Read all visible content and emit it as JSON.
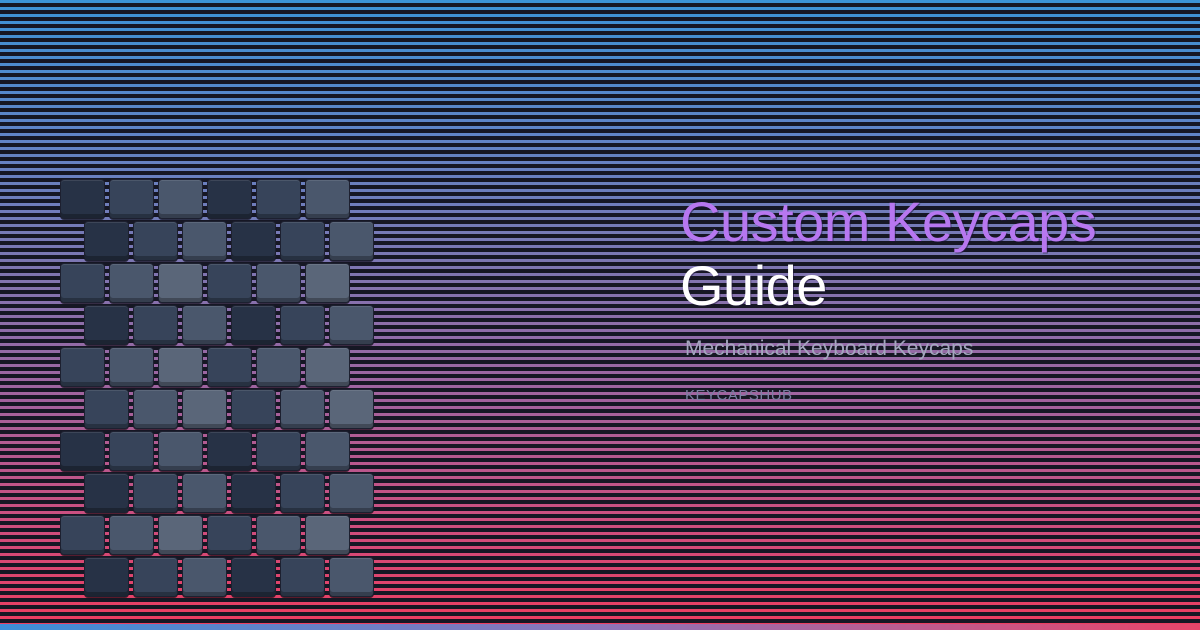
{
  "colors": {
    "title_accent": "#b777f0",
    "title_main": "#ffffff",
    "subtitle": "#a4a6be",
    "brand": "#7d7fa4",
    "stripe_top": "#3b93d6",
    "stripe_bottom": "#ee3c5f"
  },
  "title": {
    "line1": "Custom Keycaps",
    "line2": "Guide"
  },
  "subtitle": "Mechanical Keyboard Keycaps",
  "brand": "KEYCAPSHUB",
  "keycaps": {
    "icon": "keycap-grid-illustration",
    "rows": [
      [
        0,
        1,
        2,
        0,
        1,
        2
      ],
      [
        0,
        1,
        2,
        0,
        1,
        2
      ],
      [
        1,
        2,
        3,
        1,
        2,
        3
      ],
      [
        0,
        1,
        2,
        0,
        1,
        2
      ],
      [
        1,
        2,
        3,
        1,
        2,
        3
      ],
      [
        1,
        2,
        3,
        1,
        2,
        3
      ],
      [
        0,
        1,
        2,
        0,
        1,
        2
      ],
      [
        0,
        1,
        2,
        0,
        1,
        2
      ],
      [
        1,
        2,
        3,
        1,
        2,
        3
      ],
      [
        0,
        1,
        2,
        0,
        1,
        2
      ]
    ]
  }
}
